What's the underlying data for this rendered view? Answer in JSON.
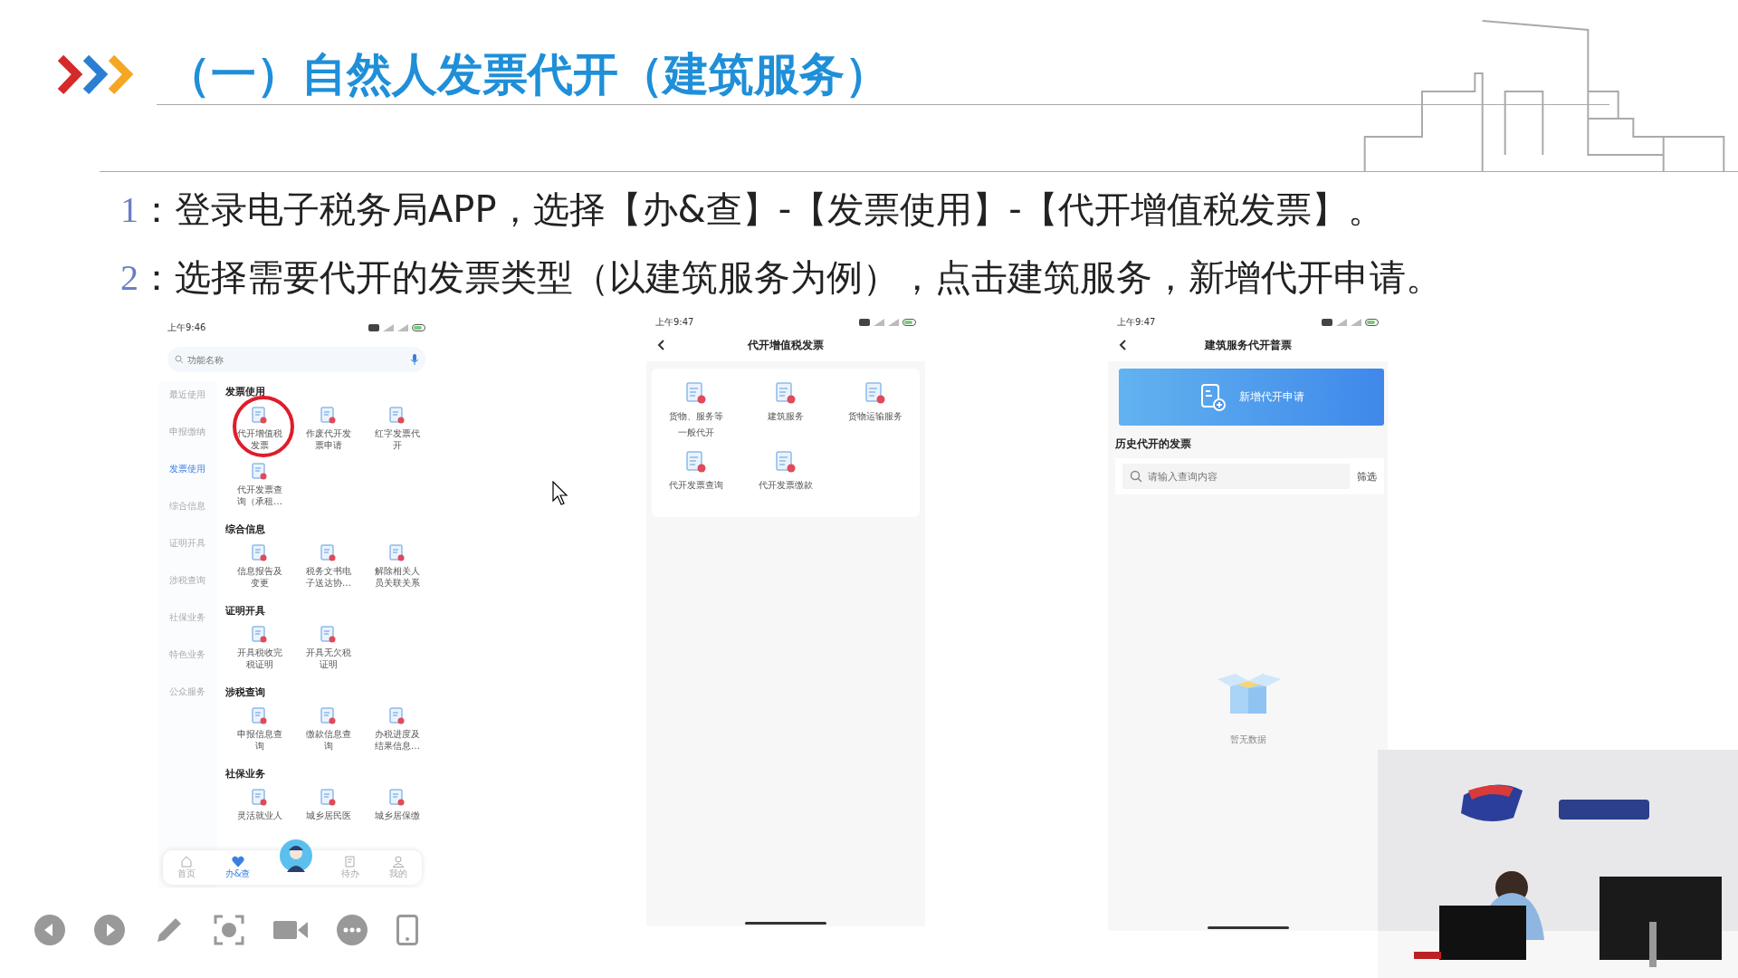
{
  "slide": {
    "title": "（一）自然人发票代开（建筑服务）",
    "steps": [
      {
        "number": "1",
        "text": "：登录电子税务局APP，选择【办&查】-【发票使用】-【代开增值税发票】。"
      },
      {
        "number": "2",
        "text": "：选择需要代开的发票类型（以建筑服务为例），点击建筑服务，新增代开申请。"
      }
    ]
  },
  "service_menu_screen": {
    "status_time": "上午9:46",
    "search": {
      "placeholder": "功能名称"
    },
    "categories": [
      {
        "label": "最近使用",
        "selected": false
      },
      {
        "label": "申报缴纳",
        "selected": false
      },
      {
        "label": "发票使用",
        "selected": true
      },
      {
        "label": "综合信息",
        "selected": false
      },
      {
        "label": "证明开具",
        "selected": false
      },
      {
        "label": "涉税查询",
        "selected": false
      },
      {
        "label": "社保业务",
        "selected": false
      },
      {
        "label": "特色业务",
        "selected": false
      },
      {
        "label": "公众服务",
        "selected": false
      }
    ],
    "sections": [
      {
        "title": "发票使用",
        "items": [
          {
            "label": "代开增值税发票",
            "circled": true
          },
          {
            "label": "作废代开发票申请",
            "circled": false
          },
          {
            "label": "红字发票代开",
            "circled": false
          },
          {
            "label": "代开发票查询（承租…",
            "circled": false
          }
        ]
      },
      {
        "title": "综合信息",
        "items": [
          {
            "label": "信息报告及变更",
            "circled": false
          },
          {
            "label": "税务文书电子送达协…",
            "circled": false
          },
          {
            "label": "解除相关人员关联关系",
            "circled": false
          }
        ]
      },
      {
        "title": "证明开具",
        "items": [
          {
            "label": "开具税收完税证明",
            "circled": false
          },
          {
            "label": "开具无欠税证明",
            "circled": false
          }
        ]
      },
      {
        "title": "涉税查询",
        "items": [
          {
            "label": "申报信息查询",
            "circled": false
          },
          {
            "label": "缴款信息查询",
            "circled": false
          },
          {
            "label": "办税进度及结果信息…",
            "circled": false
          }
        ]
      },
      {
        "title": "社保业务",
        "items": [
          {
            "label": "灵活就业人",
            "circled": false
          },
          {
            "label": "城乡居民医",
            "circled": false
          },
          {
            "label": "城乡居保缴",
            "circled": false
          }
        ]
      }
    ],
    "bottom_nav": [
      {
        "label": "首页",
        "selected": false
      },
      {
        "label": "办&查",
        "selected": true
      },
      {
        "label": "待办",
        "selected": false
      },
      {
        "label": "我的",
        "selected": false
      }
    ]
  },
  "invoice_type_screen": {
    "status_time": "上午9:47",
    "title": "代开增值税发票",
    "items": [
      {
        "label": "货物、服务等一般代开"
      },
      {
        "label": "建筑服务"
      },
      {
        "label": "货物运输服务"
      },
      {
        "label": "代开发票查询"
      },
      {
        "label": "代开发票缴款"
      }
    ]
  },
  "construction_screen": {
    "status_time": "上午9:47",
    "title": "建筑服务代开普票",
    "new_button": "新增代开申请",
    "history_title": "历史代开的发票",
    "search": {
      "placeholder": "请输入查询内容"
    },
    "filter": "筛选",
    "empty_text": "暂无数据"
  }
}
